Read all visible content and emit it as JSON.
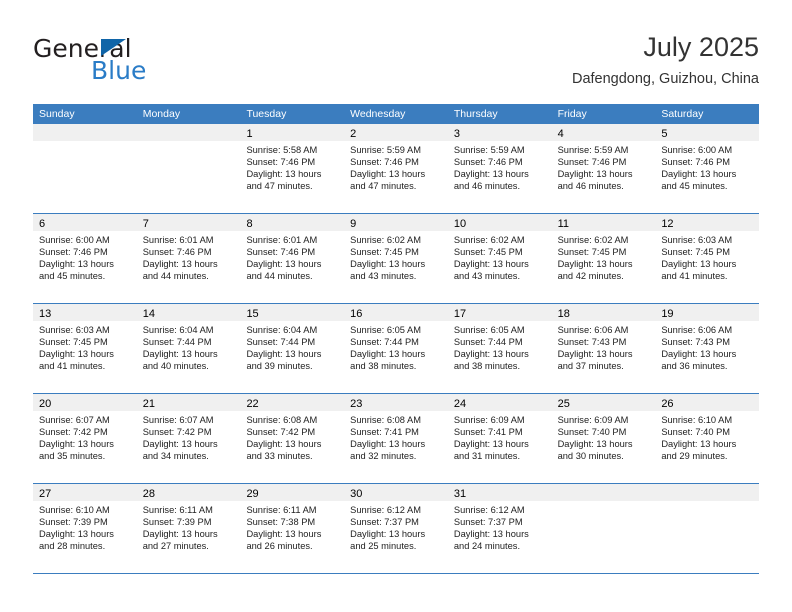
{
  "brand": {
    "name_part1": "General",
    "name_part2": "Blue",
    "triangle_color": "#1065a8",
    "blue_color": "#2a7cc7"
  },
  "header": {
    "title": "July 2025",
    "subtitle": "Dafengdong, Guizhou, China"
  },
  "theme": {
    "header_row_bg": "#3b7dbf",
    "header_row_text": "#ffffff",
    "date_strip_bg": "#f0f0f0",
    "row_divider": "#3b7dbf"
  },
  "weekdays": [
    "Sunday",
    "Monday",
    "Tuesday",
    "Wednesday",
    "Thursday",
    "Friday",
    "Saturday"
  ],
  "weeks": [
    [
      {
        "day": "",
        "sunrise": "",
        "sunset": "",
        "daylight1": "",
        "daylight2": ""
      },
      {
        "day": "",
        "sunrise": "",
        "sunset": "",
        "daylight1": "",
        "daylight2": ""
      },
      {
        "day": "1",
        "sunrise": "Sunrise: 5:58 AM",
        "sunset": "Sunset: 7:46 PM",
        "daylight1": "Daylight: 13 hours",
        "daylight2": "and 47 minutes."
      },
      {
        "day": "2",
        "sunrise": "Sunrise: 5:59 AM",
        "sunset": "Sunset: 7:46 PM",
        "daylight1": "Daylight: 13 hours",
        "daylight2": "and 47 minutes."
      },
      {
        "day": "3",
        "sunrise": "Sunrise: 5:59 AM",
        "sunset": "Sunset: 7:46 PM",
        "daylight1": "Daylight: 13 hours",
        "daylight2": "and 46 minutes."
      },
      {
        "day": "4",
        "sunrise": "Sunrise: 5:59 AM",
        "sunset": "Sunset: 7:46 PM",
        "daylight1": "Daylight: 13 hours",
        "daylight2": "and 46 minutes."
      },
      {
        "day": "5",
        "sunrise": "Sunrise: 6:00 AM",
        "sunset": "Sunset: 7:46 PM",
        "daylight1": "Daylight: 13 hours",
        "daylight2": "and 45 minutes."
      }
    ],
    [
      {
        "day": "6",
        "sunrise": "Sunrise: 6:00 AM",
        "sunset": "Sunset: 7:46 PM",
        "daylight1": "Daylight: 13 hours",
        "daylight2": "and 45 minutes."
      },
      {
        "day": "7",
        "sunrise": "Sunrise: 6:01 AM",
        "sunset": "Sunset: 7:46 PM",
        "daylight1": "Daylight: 13 hours",
        "daylight2": "and 44 minutes."
      },
      {
        "day": "8",
        "sunrise": "Sunrise: 6:01 AM",
        "sunset": "Sunset: 7:46 PM",
        "daylight1": "Daylight: 13 hours",
        "daylight2": "and 44 minutes."
      },
      {
        "day": "9",
        "sunrise": "Sunrise: 6:02 AM",
        "sunset": "Sunset: 7:45 PM",
        "daylight1": "Daylight: 13 hours",
        "daylight2": "and 43 minutes."
      },
      {
        "day": "10",
        "sunrise": "Sunrise: 6:02 AM",
        "sunset": "Sunset: 7:45 PM",
        "daylight1": "Daylight: 13 hours",
        "daylight2": "and 43 minutes."
      },
      {
        "day": "11",
        "sunrise": "Sunrise: 6:02 AM",
        "sunset": "Sunset: 7:45 PM",
        "daylight1": "Daylight: 13 hours",
        "daylight2": "and 42 minutes."
      },
      {
        "day": "12",
        "sunrise": "Sunrise: 6:03 AM",
        "sunset": "Sunset: 7:45 PM",
        "daylight1": "Daylight: 13 hours",
        "daylight2": "and 41 minutes."
      }
    ],
    [
      {
        "day": "13",
        "sunrise": "Sunrise: 6:03 AM",
        "sunset": "Sunset: 7:45 PM",
        "daylight1": "Daylight: 13 hours",
        "daylight2": "and 41 minutes."
      },
      {
        "day": "14",
        "sunrise": "Sunrise: 6:04 AM",
        "sunset": "Sunset: 7:44 PM",
        "daylight1": "Daylight: 13 hours",
        "daylight2": "and 40 minutes."
      },
      {
        "day": "15",
        "sunrise": "Sunrise: 6:04 AM",
        "sunset": "Sunset: 7:44 PM",
        "daylight1": "Daylight: 13 hours",
        "daylight2": "and 39 minutes."
      },
      {
        "day": "16",
        "sunrise": "Sunrise: 6:05 AM",
        "sunset": "Sunset: 7:44 PM",
        "daylight1": "Daylight: 13 hours",
        "daylight2": "and 38 minutes."
      },
      {
        "day": "17",
        "sunrise": "Sunrise: 6:05 AM",
        "sunset": "Sunset: 7:44 PM",
        "daylight1": "Daylight: 13 hours",
        "daylight2": "and 38 minutes."
      },
      {
        "day": "18",
        "sunrise": "Sunrise: 6:06 AM",
        "sunset": "Sunset: 7:43 PM",
        "daylight1": "Daylight: 13 hours",
        "daylight2": "and 37 minutes."
      },
      {
        "day": "19",
        "sunrise": "Sunrise: 6:06 AM",
        "sunset": "Sunset: 7:43 PM",
        "daylight1": "Daylight: 13 hours",
        "daylight2": "and 36 minutes."
      }
    ],
    [
      {
        "day": "20",
        "sunrise": "Sunrise: 6:07 AM",
        "sunset": "Sunset: 7:42 PM",
        "daylight1": "Daylight: 13 hours",
        "daylight2": "and 35 minutes."
      },
      {
        "day": "21",
        "sunrise": "Sunrise: 6:07 AM",
        "sunset": "Sunset: 7:42 PM",
        "daylight1": "Daylight: 13 hours",
        "daylight2": "and 34 minutes."
      },
      {
        "day": "22",
        "sunrise": "Sunrise: 6:08 AM",
        "sunset": "Sunset: 7:42 PM",
        "daylight1": "Daylight: 13 hours",
        "daylight2": "and 33 minutes."
      },
      {
        "day": "23",
        "sunrise": "Sunrise: 6:08 AM",
        "sunset": "Sunset: 7:41 PM",
        "daylight1": "Daylight: 13 hours",
        "daylight2": "and 32 minutes."
      },
      {
        "day": "24",
        "sunrise": "Sunrise: 6:09 AM",
        "sunset": "Sunset: 7:41 PM",
        "daylight1": "Daylight: 13 hours",
        "daylight2": "and 31 minutes."
      },
      {
        "day": "25",
        "sunrise": "Sunrise: 6:09 AM",
        "sunset": "Sunset: 7:40 PM",
        "daylight1": "Daylight: 13 hours",
        "daylight2": "and 30 minutes."
      },
      {
        "day": "26",
        "sunrise": "Sunrise: 6:10 AM",
        "sunset": "Sunset: 7:40 PM",
        "daylight1": "Daylight: 13 hours",
        "daylight2": "and 29 minutes."
      }
    ],
    [
      {
        "day": "27",
        "sunrise": "Sunrise: 6:10 AM",
        "sunset": "Sunset: 7:39 PM",
        "daylight1": "Daylight: 13 hours",
        "daylight2": "and 28 minutes."
      },
      {
        "day": "28",
        "sunrise": "Sunrise: 6:11 AM",
        "sunset": "Sunset: 7:39 PM",
        "daylight1": "Daylight: 13 hours",
        "daylight2": "and 27 minutes."
      },
      {
        "day": "29",
        "sunrise": "Sunrise: 6:11 AM",
        "sunset": "Sunset: 7:38 PM",
        "daylight1": "Daylight: 13 hours",
        "daylight2": "and 26 minutes."
      },
      {
        "day": "30",
        "sunrise": "Sunrise: 6:12 AM",
        "sunset": "Sunset: 7:37 PM",
        "daylight1": "Daylight: 13 hours",
        "daylight2": "and 25 minutes."
      },
      {
        "day": "31",
        "sunrise": "Sunrise: 6:12 AM",
        "sunset": "Sunset: 7:37 PM",
        "daylight1": "Daylight: 13 hours",
        "daylight2": "and 24 minutes."
      },
      {
        "day": "",
        "sunrise": "",
        "sunset": "",
        "daylight1": "",
        "daylight2": ""
      },
      {
        "day": "",
        "sunrise": "",
        "sunset": "",
        "daylight1": "",
        "daylight2": ""
      }
    ]
  ]
}
